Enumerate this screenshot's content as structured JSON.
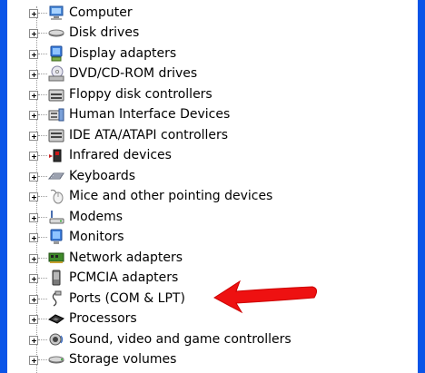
{
  "device_tree": {
    "items": [
      {
        "label": "Computer",
        "icon": "computer-icon"
      },
      {
        "label": "Disk drives",
        "icon": "disk-drive-icon"
      },
      {
        "label": "Display adapters",
        "icon": "display-adapter-icon"
      },
      {
        "label": "DVD/CD-ROM drives",
        "icon": "dvd-drive-icon"
      },
      {
        "label": "Floppy disk controllers",
        "icon": "floppy-controller-icon"
      },
      {
        "label": "Human Interface Devices",
        "icon": "hid-icon"
      },
      {
        "label": "IDE ATA/ATAPI controllers",
        "icon": "ide-controller-icon"
      },
      {
        "label": "Infrared devices",
        "icon": "infrared-icon"
      },
      {
        "label": "Keyboards",
        "icon": "keyboard-icon"
      },
      {
        "label": "Mice and other pointing devices",
        "icon": "mouse-icon"
      },
      {
        "label": "Modems",
        "icon": "modem-icon"
      },
      {
        "label": "Monitors",
        "icon": "monitor-icon"
      },
      {
        "label": "Network adapters",
        "icon": "network-adapter-icon"
      },
      {
        "label": "PCMCIA adapters",
        "icon": "pcmcia-icon"
      },
      {
        "label": "Ports (COM & LPT)",
        "icon": "port-icon"
      },
      {
        "label": "Processors",
        "icon": "processor-icon"
      },
      {
        "label": "Sound, video and game controllers",
        "icon": "sound-icon"
      },
      {
        "label": "Storage volumes",
        "icon": "storage-volume-icon"
      }
    ]
  },
  "colors": {
    "window_frame": "#0a55e8",
    "annotation_arrow": "#ee1111"
  }
}
